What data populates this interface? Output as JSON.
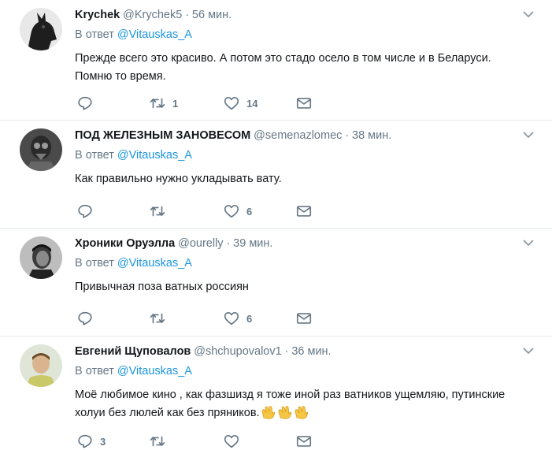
{
  "reply_prefix": "В ответ",
  "tweets": [
    {
      "name": "Krychek",
      "handle": "@Krychek5",
      "sep": "·",
      "time": "56 мин.",
      "reply_to": "@Vitauskas_A",
      "text": "Прежде всего это красиво. А потом это стадо осело в том числе и в Беларуси. Помню то время.",
      "emoji": "",
      "retweets": "1",
      "likes": "14",
      "replies": ""
    },
    {
      "name": "ПОД ЖЕЛЕЗНЫМ ЗАНОВЕСОМ",
      "handle": "@semenazlomec",
      "sep": "·",
      "time": "38 мин.",
      "reply_to": "@Vitauskas_A",
      "text": "Как правильно нужно укладывать вату.",
      "emoji": "",
      "retweets": "",
      "likes": "6",
      "replies": ""
    },
    {
      "name": "Хроники Оруэлла",
      "handle": "@ourelly",
      "sep": "·",
      "time": "39 мин.",
      "reply_to": "@Vitauskas_A",
      "text": "Привычная поза ватных россиян",
      "emoji": "",
      "retweets": "",
      "likes": "6",
      "replies": ""
    },
    {
      "name": "Евгений Щуповалов",
      "handle": "@shchupovalov1",
      "sep": "·",
      "time": "36 мин.",
      "reply_to": "@Vitauskas_A",
      "text": "Моё любимое кино , как фазшизд я тоже иной раз ватников ущемляю, путинские холуи  без люлей как без пряников.",
      "emoji": "👏👏👏",
      "retweets": "",
      "likes": "",
      "replies": "3"
    }
  ],
  "icons": {
    "reply": "reply-icon",
    "retweet": "retweet-icon",
    "like": "heart-icon",
    "dm": "envelope-icon",
    "caret": "chevron-down-icon",
    "clap": "clapping-hands-icon"
  },
  "colors": {
    "link": "#1b95e0",
    "secondary": "#657786",
    "text": "#14171a",
    "divider": "#e6ecf0"
  }
}
